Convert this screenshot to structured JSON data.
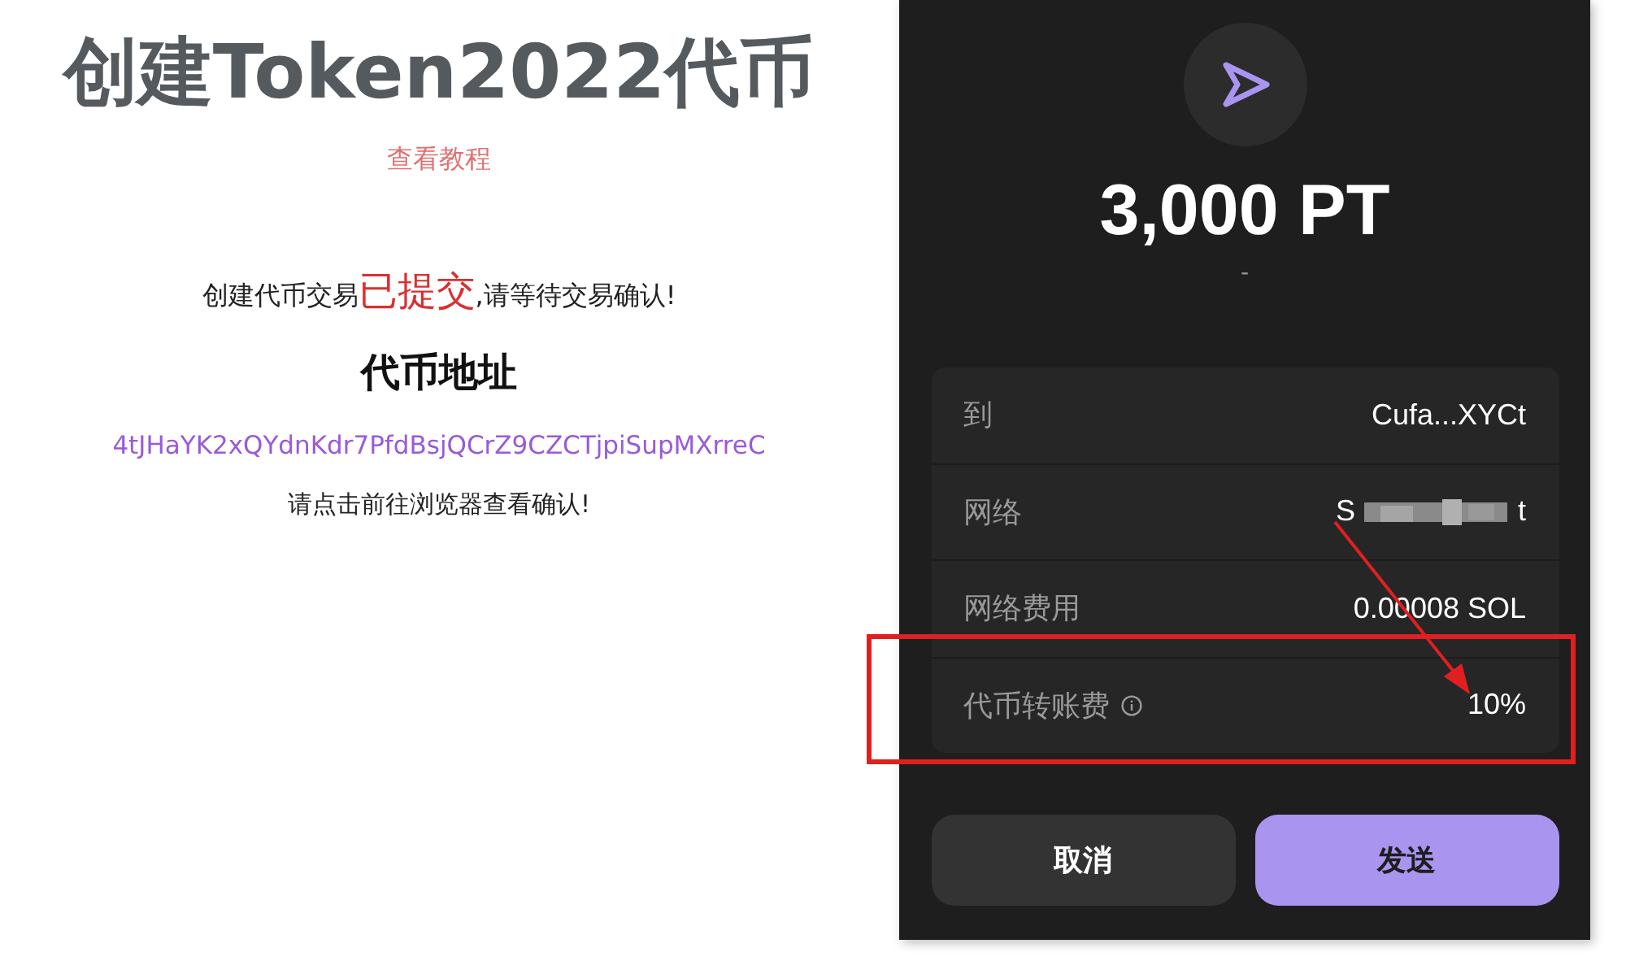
{
  "left": {
    "title": "创建Token2022代币",
    "tutorial_link": "查看教程",
    "status": {
      "before": "创建代币交易",
      "highlight": "已提交",
      "after": ",请等待交易确认!"
    },
    "address_heading": "代币地址",
    "address": "4tJHaYK2xQYdnKdr7PfdBsjQCrZ9CZCTjpiSupMXrreC",
    "hint": "请点击前往浏览器查看确认!"
  },
  "wallet": {
    "amount": "3,000 PT",
    "sub": "-",
    "rows": [
      {
        "kind": "text",
        "label": "到",
        "value": "Cufa...XYCt",
        "info": false
      },
      {
        "kind": "blurred",
        "label": "网络",
        "start": "S",
        "end": "t",
        "info": false
      },
      {
        "kind": "text",
        "label": "网络费用",
        "value": "0.00008 SOL",
        "info": false
      },
      {
        "kind": "text",
        "label": "代币转账费",
        "value": "10%",
        "info": true
      }
    ],
    "buttons": [
      {
        "kind": "secondary",
        "label": "取消"
      },
      {
        "kind": "primary",
        "label": "发送"
      }
    ]
  }
}
